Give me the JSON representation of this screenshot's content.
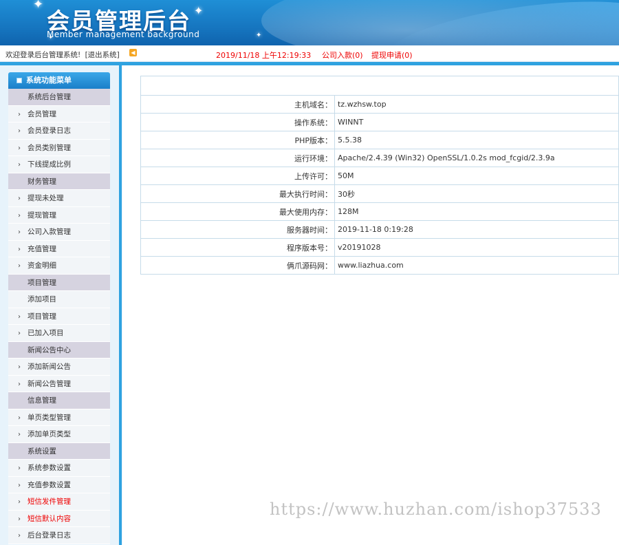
{
  "header": {
    "title": "会员管理后台",
    "subtitle": "Member management background"
  },
  "topbar": {
    "welcome": "欢迎登录后台管理系统!",
    "logout": "[退出系统]",
    "datetime": "2019/11/18 上午12:19:33",
    "company_deposit": "公司入款(0)",
    "withdraw_request": "提现申请(0)"
  },
  "sidebar": {
    "title": "系统功能菜单",
    "sections": [
      {
        "category": "系统后台管理",
        "items": [
          {
            "label": "会员管理",
            "arrow": true
          },
          {
            "label": "会员登录日志",
            "arrow": true
          },
          {
            "label": "会员类别管理",
            "arrow": true
          },
          {
            "label": "下线提成比例",
            "arrow": true
          }
        ]
      },
      {
        "category": "财务管理",
        "items": [
          {
            "label": "提现未处理",
            "arrow": true
          },
          {
            "label": "提现管理",
            "arrow": true
          },
          {
            "label": "公司入款管理",
            "arrow": true
          },
          {
            "label": "充值管理",
            "arrow": true
          },
          {
            "label": "资金明细",
            "arrow": true
          }
        ]
      },
      {
        "category": "项目管理",
        "items": [
          {
            "label": "添加项目",
            "arrow": false
          },
          {
            "label": "项目管理",
            "arrow": true
          },
          {
            "label": "已加入项目",
            "arrow": true
          }
        ]
      },
      {
        "category": "新闻公告中心",
        "items": [
          {
            "label": "添加新闻公告",
            "arrow": true
          },
          {
            "label": "新闻公告管理",
            "arrow": true
          }
        ]
      },
      {
        "category": "信息管理",
        "items": [
          {
            "label": "单页类型管理",
            "arrow": true
          },
          {
            "label": "添加单页类型",
            "arrow": true
          }
        ]
      },
      {
        "category": "系统设置",
        "items": [
          {
            "label": "系统参数设置",
            "arrow": true
          },
          {
            "label": "充值参数设置",
            "arrow": true
          },
          {
            "label": "短信发件管理",
            "arrow": true,
            "red": true
          },
          {
            "label": "短信默认内容",
            "arrow": true,
            "red": true
          },
          {
            "label": "后台登录日志",
            "arrow": true
          }
        ]
      }
    ]
  },
  "info": {
    "rows": [
      {
        "key": "主机域名：",
        "value": "tz.wzhsw.top"
      },
      {
        "key": "操作系统：",
        "value": "WINNT"
      },
      {
        "key": "PHP版本：",
        "value": "5.5.38"
      },
      {
        "key": "运行环境：",
        "value": "Apache/2.4.39 (Win32) OpenSSL/1.0.2s mod_fcgid/2.3.9a"
      },
      {
        "key": "上传许可：",
        "value": "50M"
      },
      {
        "key": "最大执行时间：",
        "value": "30秒"
      },
      {
        "key": "最大使用内存：",
        "value": "128M"
      },
      {
        "key": "服务器时间：",
        "value": "2019-11-18 0:19:28"
      },
      {
        "key": "程序版本号：",
        "value": "v20191028"
      },
      {
        "key": "俩爪源码网：",
        "value": "www.liazhua.com"
      }
    ]
  },
  "watermark": "https://www.huzhan.com/ishop37533",
  "colors": {
    "header_blue": "#1676c0",
    "accent_blue": "#2fa2e0",
    "alert_red": "#e00000",
    "category_bg": "#d6d3e0"
  }
}
